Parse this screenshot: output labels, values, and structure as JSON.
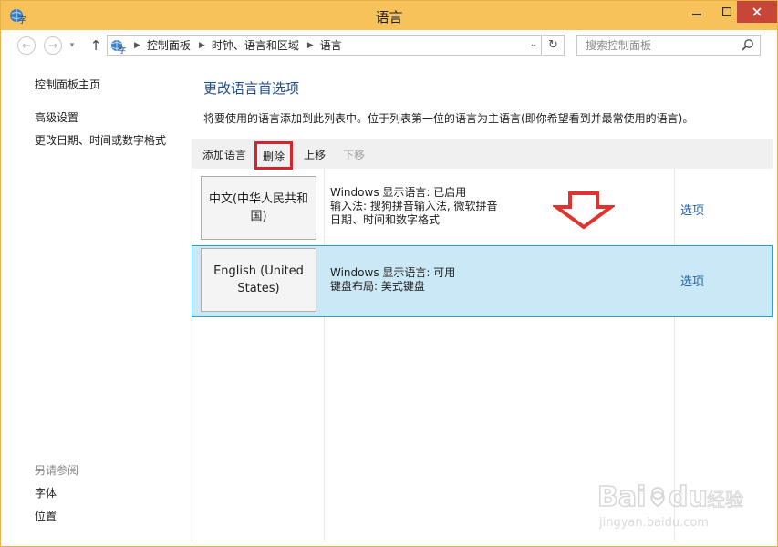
{
  "window": {
    "title": "语言"
  },
  "address": {
    "crumbs": [
      "控制面板",
      "时钟、语言和区域",
      "语言"
    ],
    "search_placeholder": "搜索控制面板"
  },
  "leftnav": {
    "home": "控制面板主页",
    "links": [
      "高级设置",
      "更改日期、时间或数字格式"
    ],
    "see_also_title": "另请参阅",
    "see_also": [
      "字体",
      "位置"
    ]
  },
  "main": {
    "heading": "更改语言首选项",
    "description": "将要使用的语言添加到此列表中。位于列表第一位的语言为主语言(即你希望看到并最常使用的语言)。",
    "toolbar": {
      "add": "添加语言",
      "delete": "删除",
      "up": "上移",
      "down": "下移"
    },
    "languages": [
      {
        "name": "中文(中华人民共和国)",
        "info": [
          "Windows 显示语言: 已启用",
          "输入法: 搜狗拼音输入法, 微软拼音",
          "日期、时间和数字格式"
        ],
        "options": "选项"
      },
      {
        "name": "English (United States)",
        "info": [
          "Windows 显示语言: 可用",
          "键盘布局: 美式键盘"
        ],
        "options": "选项"
      }
    ]
  },
  "watermark": {
    "brand": "Baidu经验",
    "url": "jingyan.baidu.com"
  },
  "colors": {
    "titlebar": "#f7c25a",
    "selected_row": "#cbe8f6",
    "highlight_box": "#d6242a",
    "arrow": "#e0322e",
    "link": "#1e5fa8"
  }
}
